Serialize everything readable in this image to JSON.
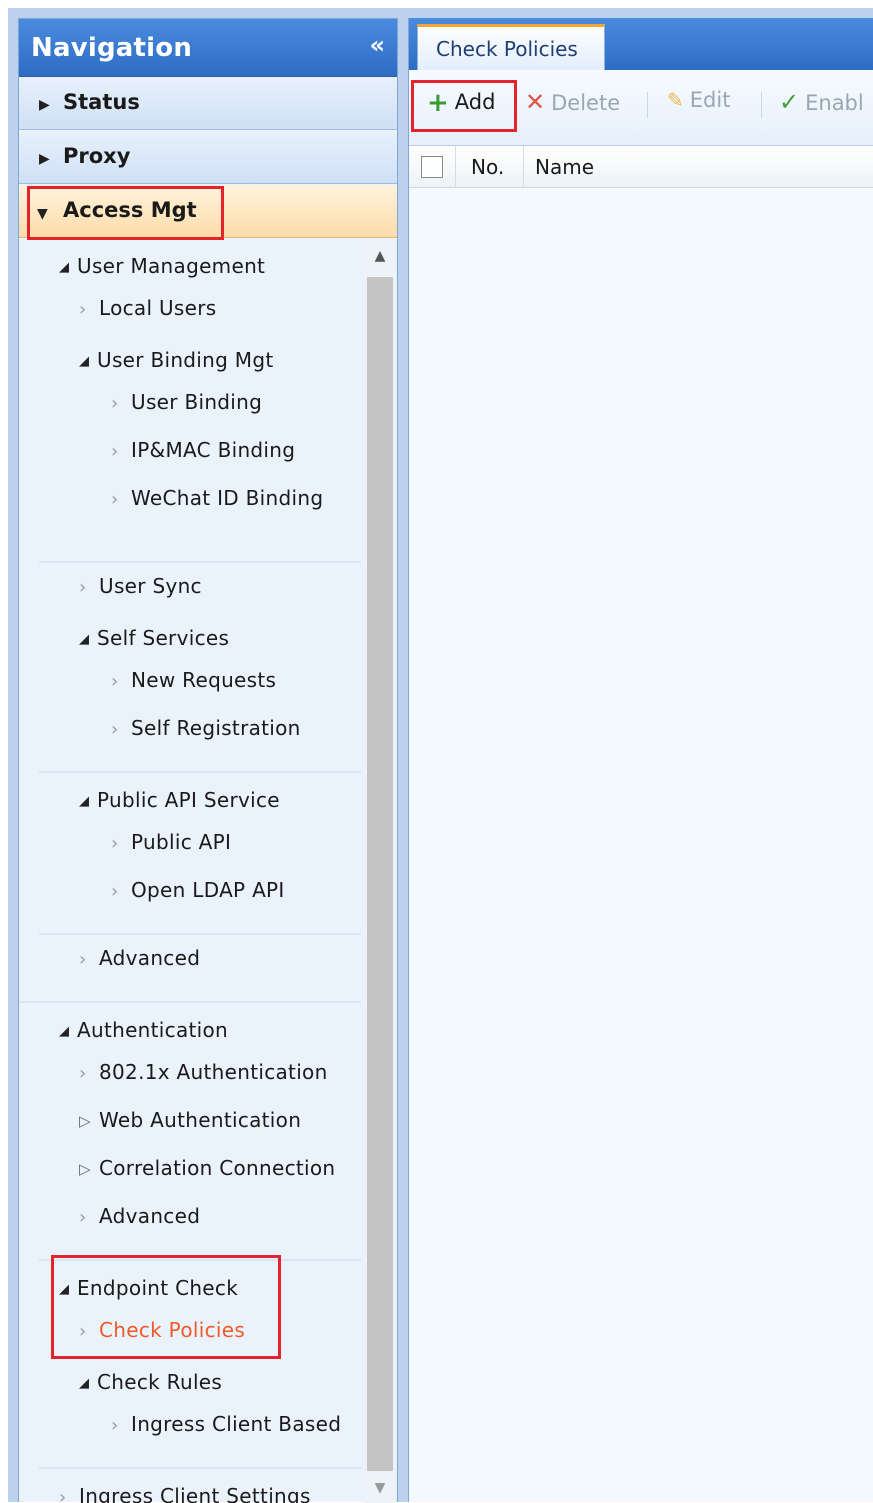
{
  "navigation": {
    "title": "Navigation",
    "collapse_glyph": "«",
    "sections": {
      "status": "Status",
      "proxy": "Proxy",
      "access_mgt": "Access Mgt"
    },
    "tree": {
      "user_management": "User Management",
      "local_users": "Local Users",
      "user_binding_mgt": "User Binding Mgt",
      "user_binding": "User Binding",
      "ip_mac_binding": "IP&MAC Binding",
      "wechat_id_binding": "WeChat ID Binding",
      "user_sync": "User Sync",
      "self_services": "Self Services",
      "new_requests": "New Requests",
      "self_registration": "Self Registration",
      "public_api_service": "Public API Service",
      "public_api": "Public API",
      "open_ldap_api": "Open LDAP API",
      "advanced_1": "Advanced",
      "authentication": "Authentication",
      "auth_8021x": "802.1x Authentication",
      "web_authentication": "Web Authentication",
      "correlation_connection": "Correlation Connection",
      "advanced_2": "Advanced",
      "endpoint_check": "Endpoint Check",
      "check_policies": "Check Policies",
      "check_rules": "Check Rules",
      "ingress_client_based": "Ingress Client Based",
      "ingress_client_settings": "Ingress Client Settings"
    },
    "selected_item": "Check Policies"
  },
  "content": {
    "tab_label": "Check Policies",
    "toolbar": {
      "add": "Add",
      "delete": "Delete",
      "edit": "Edit",
      "enable": "Enabl"
    },
    "grid": {
      "columns": [
        "No.",
        "Name"
      ]
    }
  },
  "colors": {
    "header_blue": "#2d6cc3",
    "active_section": "#fddcaa",
    "highlight_red": "#e5232b",
    "selected_text": "#f05a28",
    "add_green": "#3b9b2e"
  }
}
